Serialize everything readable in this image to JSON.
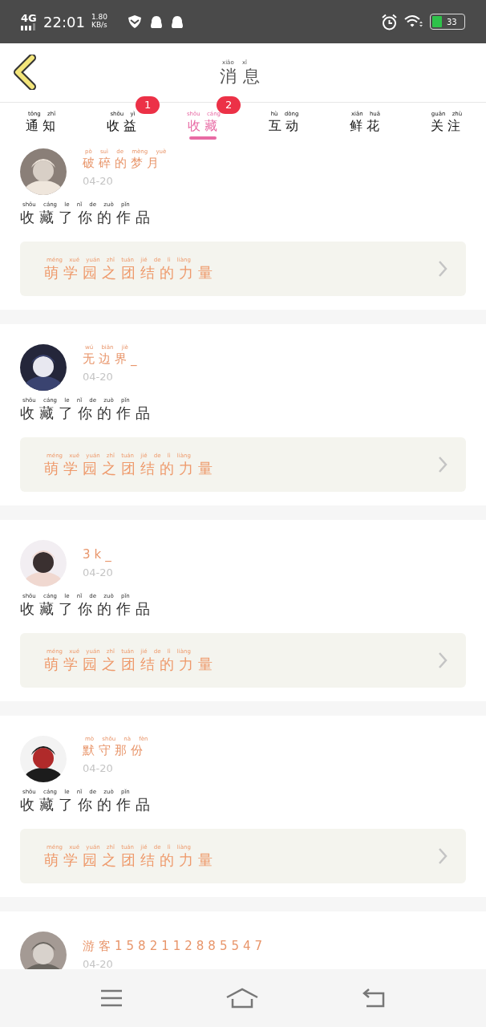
{
  "status_bar": {
    "network": "4G",
    "time": "22:01",
    "speed": "1.80",
    "speed_unit": "KB/s",
    "battery": "33"
  },
  "header": {
    "title": "消息",
    "title_pinyin": "xiāo xī"
  },
  "tabs": [
    {
      "label": "通知",
      "pinyin": "tōng zhī",
      "selected": false
    },
    {
      "label": "收益",
      "pinyin": "shōu yì",
      "selected": false,
      "badge": "1"
    },
    {
      "label": "收藏",
      "pinyin": "shōu cáng",
      "selected": true,
      "badge": "2"
    },
    {
      "label": "互动",
      "pinyin": "hù dòng",
      "selected": false
    },
    {
      "label": "鲜花",
      "pinyin": "xiān huā",
      "selected": false
    },
    {
      "label": "关注",
      "pinyin": "guān zhù",
      "selected": false
    }
  ],
  "messages": [
    {
      "name": "破碎的梦月",
      "name_pinyin": "pò suì de mèng yuè",
      "date": "04-20",
      "action": "收藏了你的作品",
      "action_pinyin": "shōu cáng le nǐ de zuò pǐn",
      "work": "萌学园之团结的力量",
      "work_pinyin": "méng xué yuán zhī tuán jié de lì liàng"
    },
    {
      "name": "无边界_",
      "name_pinyin": "wú biān jiè",
      "date": "04-20",
      "action": "收藏了你的作品",
      "action_pinyin": "shōu cáng le nǐ de zuò pǐn",
      "work": "萌学园之团结的力量",
      "work_pinyin": "méng xué yuán zhī tuán jié de lì liàng"
    },
    {
      "name": "3k_",
      "date": "04-20",
      "action": "收藏了你的作品",
      "action_pinyin": "shōu cáng le nǐ de zuò pǐn",
      "work": "萌学园之团结的力量",
      "work_pinyin": "méng xué yuán zhī tuán jié de lì liàng"
    },
    {
      "name": "默守那份",
      "name_pinyin": "mò shǒu nà fèn",
      "date": "04-20",
      "action": "收藏了你的作品",
      "action_pinyin": "shōu cáng le nǐ de zuò pǐn",
      "work": "萌学园之团结的力量",
      "work_pinyin": "méng xué yuán zhī tuán jié de lì liàng"
    },
    {
      "name": "游客1582112885547",
      "date": "04-20"
    }
  ]
}
